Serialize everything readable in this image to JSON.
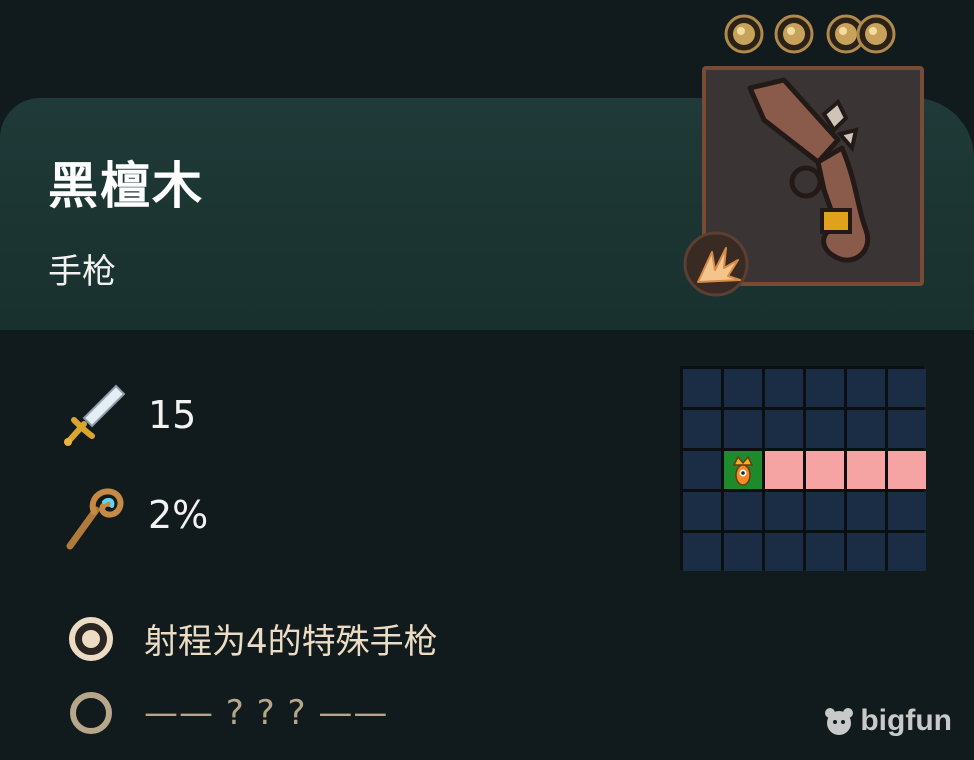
{
  "item": {
    "name": "黑檀木",
    "type": "手枪"
  },
  "cost": {
    "coin_count": 4,
    "coin_icon": "gold-coin-icon"
  },
  "portrait": {
    "icon": "flintlock-pistol-icon",
    "badge_icon": "burst-attack-icon"
  },
  "stats": [
    {
      "icon": "sword-icon",
      "value": "15"
    },
    {
      "icon": "staff-icon",
      "value": "2%"
    }
  ],
  "range_grid": {
    "rows": 5,
    "cols": 6,
    "origin": {
      "row": 2,
      "col": 1
    },
    "highlighted": [
      {
        "row": 2,
        "col": 2
      },
      {
        "row": 2,
        "col": 3
      },
      {
        "row": 2,
        "col": 4
      },
      {
        "row": 2,
        "col": 5
      }
    ],
    "unit_icon": "crowned-unit-icon"
  },
  "abilities": [
    {
      "icon": "active-ring-icon",
      "text": "射程为4的特殊手枪"
    },
    {
      "icon": "empty-ring-icon",
      "text": "—— ? ? ? ——"
    }
  ],
  "watermark": {
    "text": "bigfun"
  },
  "colors": {
    "background": "#111a1c",
    "header": "#1f3a38",
    "grid_cell": "#1a2d45",
    "range_cell": "#f5a3a3",
    "origin_cell": "#1f8a2c",
    "ability_text": "#ecdcc4"
  }
}
